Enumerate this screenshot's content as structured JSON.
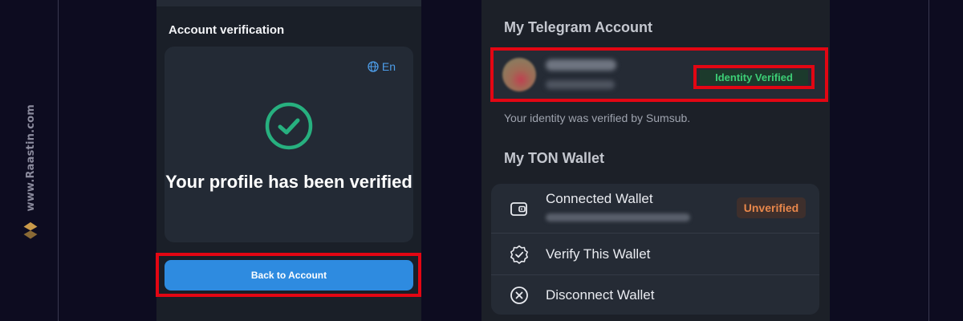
{
  "watermark": {
    "text": "www.Raastin.com",
    "logo_icon": "raastin-logo-icon"
  },
  "verification_panel": {
    "section_title": "Account verification",
    "language": {
      "icon": "globe-icon",
      "label": "En"
    },
    "status_icon": "check-circle-icon",
    "message": "Your profile has been verified",
    "back_button": "Back to Account"
  },
  "account_panel": {
    "telegram_title": "My Telegram Account",
    "identity_badge": "Identity Verified",
    "verification_note": "Your identity was verified by Sumsub.",
    "wallet_title": "My TON Wallet",
    "wallet_items": [
      {
        "label": "Connected Wallet",
        "icon": "wallet-icon",
        "status": "Unverified"
      },
      {
        "label": "Verify This Wallet",
        "icon": "badge-check-icon"
      },
      {
        "label": "Disconnect Wallet",
        "icon": "x-circle-icon"
      }
    ]
  },
  "colors": {
    "background": "#0d0c20",
    "accent_blue": "#2e8be0",
    "success_green": "#3ccd75",
    "warning_orange": "#e8874b",
    "highlight_red": "#e30613"
  }
}
